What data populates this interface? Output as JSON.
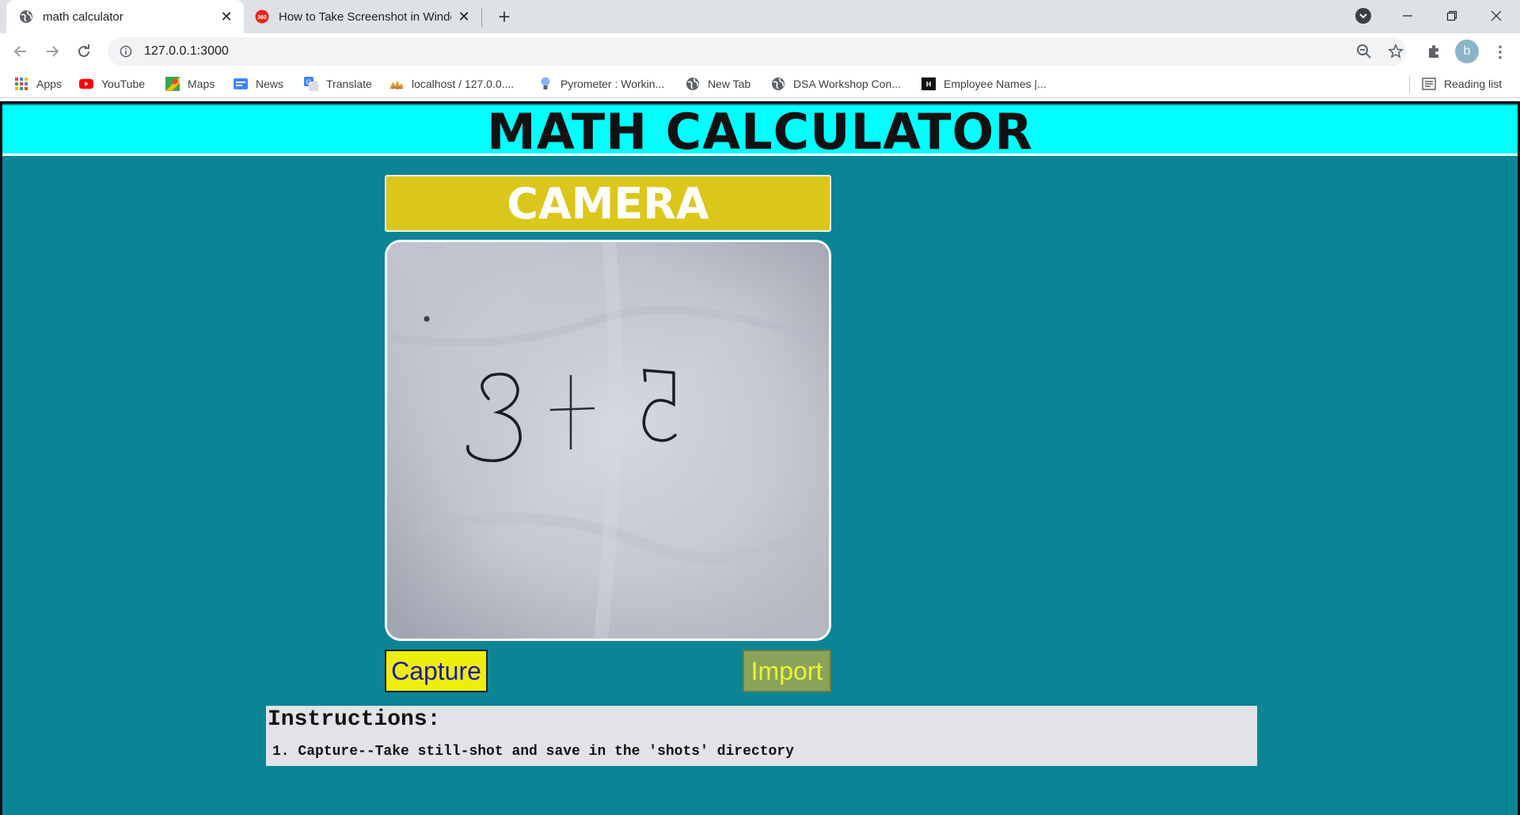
{
  "browser": {
    "tabs": [
      {
        "title": "math calculator",
        "active": true
      },
      {
        "title": "How to Take Screenshot in Windo",
        "active": false
      }
    ],
    "address": "127.0.0.1:3000",
    "profile_initial": "b",
    "bookmarks": [
      {
        "label": "Apps",
        "icon": "apps-grid-icon"
      },
      {
        "label": "YouTube",
        "icon": "youtube-icon"
      },
      {
        "label": "Maps",
        "icon": "maps-icon"
      },
      {
        "label": "News",
        "icon": "news-icon"
      },
      {
        "label": "Translate",
        "icon": "translate-icon"
      },
      {
        "label": "localhost / 127.0.0....",
        "icon": "phpmyadmin-icon"
      },
      {
        "label": "Pyrometer : Workin...",
        "icon": "lightbulb-icon"
      },
      {
        "label": "New Tab",
        "icon": "globe-icon"
      },
      {
        "label": "DSA Workshop Con...",
        "icon": "globe-icon"
      },
      {
        "label": "Employee Names |...",
        "icon": "hackerearth-icon"
      }
    ],
    "reading_list": "Reading list"
  },
  "page": {
    "title": "MATH CALCULATOR",
    "camera_label": "CAMERA",
    "capture_label": "Capture",
    "import_label": "Import",
    "instructions": {
      "heading": "Instructions:",
      "items": [
        "1. Capture--Take still-shot and save in the 'shots' directory"
      ]
    }
  },
  "colors": {
    "page_background": "#0b8596",
    "header_background": "#00ffff",
    "camera_banner": "#dbc71b",
    "capture_button": "#eeee0c",
    "import_button": "#8aa35a"
  }
}
